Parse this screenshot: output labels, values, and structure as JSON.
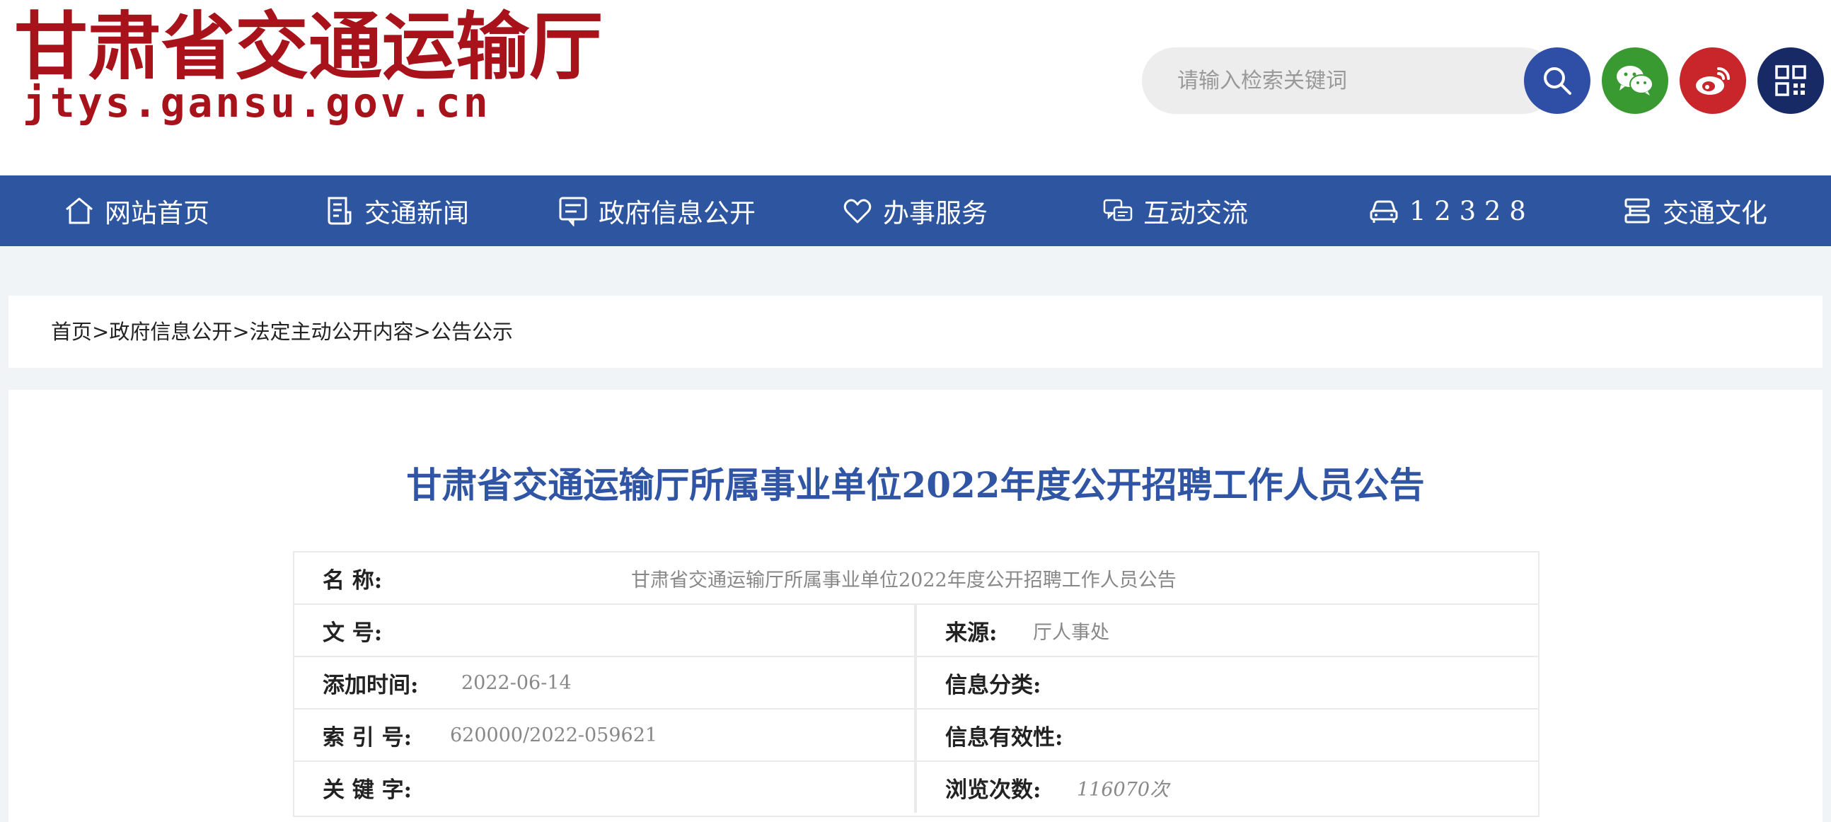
{
  "header": {
    "logo_cn": "甘肃省交通运输厅",
    "logo_en": "jtys.gansu.gov.cn",
    "search_placeholder": "请输入检索关键词",
    "icons": [
      "search-icon",
      "wechat-icon",
      "weibo-icon",
      "qrcode-icon"
    ]
  },
  "nav": {
    "items": [
      {
        "label": "网站首页",
        "icon": "home-icon"
      },
      {
        "label": "交通新闻",
        "icon": "news-icon"
      },
      {
        "label": "政府信息公开",
        "icon": "info-icon"
      },
      {
        "label": "办事服务",
        "icon": "heart-icon"
      },
      {
        "label": "互动交流",
        "icon": "chat-icon"
      },
      {
        "label": "1 2 3 2 8",
        "icon": "car-icon"
      },
      {
        "label": "交通文化",
        "icon": "culture-icon"
      }
    ]
  },
  "breadcrumb": {
    "items": [
      "首页",
      "政府信息公开",
      "法定主动公开内容",
      "公告公示"
    ],
    "separator": ">"
  },
  "article": {
    "title": "甘肃省交通运输厅所属事业单位2022年度公开招聘工作人员公告",
    "fields": {
      "name_label": "名 称:",
      "name_value": "甘肃省交通运输厅所属事业单位2022年度公开招聘工作人员公告",
      "docno_label": "文 号:",
      "docno_value": "",
      "source_label": "来源:",
      "source_value": "厅人事处",
      "date_label": "添加时间:",
      "date_value": "2022-06-14",
      "category_label": "信息分类:",
      "category_value": "",
      "index_label": "索 引 号:",
      "index_value": "620000/2022-059621",
      "validity_label": "信息有效性:",
      "validity_value": "",
      "keywords_label": "关 键 字:",
      "keywords_value": "",
      "views_label": "浏览次数:",
      "views_value": "116070次"
    }
  },
  "colors": {
    "brand_red": "#a8121a",
    "nav_blue": "#2e55a0",
    "title_blue": "#2f55a4",
    "search_blue": "#2f4fa6",
    "wechat_green": "#3a9a32",
    "weibo_red": "#c8262a",
    "qr_navy": "#172a66"
  }
}
